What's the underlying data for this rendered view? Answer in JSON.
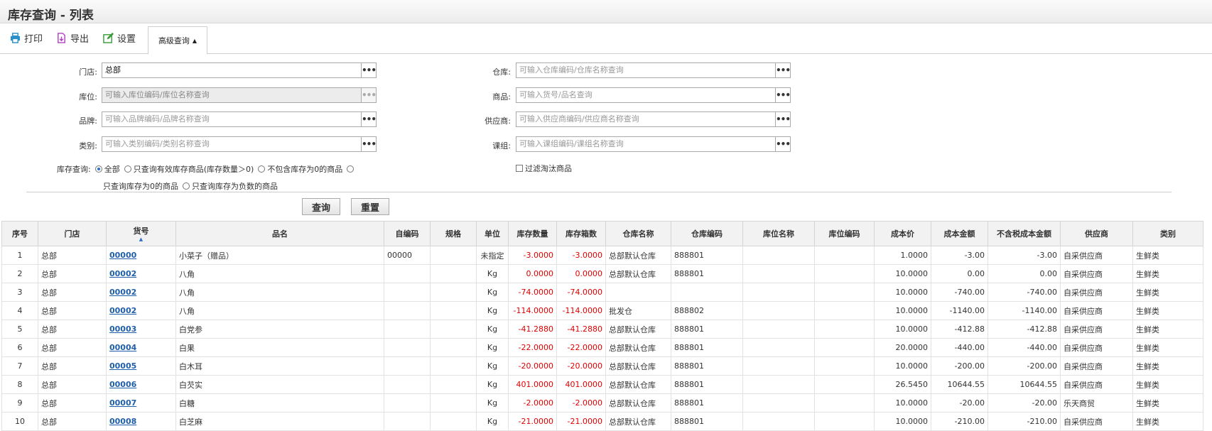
{
  "window": {
    "title": "库存查询 - 列表"
  },
  "toolbar": {
    "print": "打印",
    "export": "导出",
    "settings": "设置",
    "advanced": "高级查询"
  },
  "filters": {
    "store": {
      "label": "门店:",
      "value": "总部"
    },
    "location": {
      "label": "库位:",
      "placeholder": "可输入库位编码/库位名称查询"
    },
    "brand": {
      "label": "品牌:",
      "placeholder": "可输入品牌编码/品牌名称查询"
    },
    "category": {
      "label": "类别:",
      "placeholder": "可输入类别编码/类别名称查询"
    },
    "warehouse": {
      "label": "仓库:",
      "placeholder": "可输入仓库编码/仓库名称查询"
    },
    "product": {
      "label": "商品:",
      "placeholder": "可输入货号/品名查询"
    },
    "supplier": {
      "label": "供应商:",
      "placeholder": "可输入供应商编码/供应商名称查询"
    },
    "group": {
      "label": "课组:",
      "placeholder": "可输入课组编码/课组名称查询"
    },
    "stock_query": {
      "label": "库存查询:",
      "options": [
        "全部",
        "只查询有效库存商品(库存数量＞0)",
        "不包含库存为0的商品",
        "只查询库存为0的商品",
        "只查询库存为负数的商品"
      ],
      "selected": "全部"
    },
    "filter_eliminated": "过滤淘汰商品"
  },
  "actions": {
    "query": "查询",
    "reset": "重置"
  },
  "table": {
    "columns": [
      "序号",
      "门店",
      "货号",
      "品名",
      "自编码",
      "规格",
      "单位",
      "库存数量",
      "库存箱数",
      "仓库名称",
      "仓库编码",
      "库位名称",
      "库位编码",
      "成本价",
      "成本金额",
      "不含税成本金额",
      "供应商",
      "类别"
    ],
    "rows": [
      [
        "1",
        "总部",
        "00000",
        "小菜子（赠品）",
        "00000",
        "",
        "未指定",
        "-3.0000",
        "-3.0000",
        "总部默认仓库",
        "888801",
        "",
        "",
        "1.0000",
        "-3.00",
        "-3.00",
        "自采供应商",
        "生鲜类"
      ],
      [
        "2",
        "总部",
        "00002",
        "八角",
        "",
        "",
        "Kg",
        "0.0000",
        "0.0000",
        "总部默认仓库",
        "888801",
        "",
        "",
        "10.0000",
        "0.00",
        "0.00",
        "自采供应商",
        "生鲜类"
      ],
      [
        "3",
        "总部",
        "00002",
        "八角",
        "",
        "",
        "Kg",
        "-74.0000",
        "-74.0000",
        "",
        "",
        "",
        "",
        "10.0000",
        "-740.00",
        "-740.00",
        "自采供应商",
        "生鲜类"
      ],
      [
        "4",
        "总部",
        "00002",
        "八角",
        "",
        "",
        "Kg",
        "-114.0000",
        "-114.0000",
        "批发仓",
        "888802",
        "",
        "",
        "10.0000",
        "-1140.00",
        "-1140.00",
        "自采供应商",
        "生鲜类"
      ],
      [
        "5",
        "总部",
        "00003",
        "白党参",
        "",
        "",
        "Kg",
        "-41.2880",
        "-41.2880",
        "总部默认仓库",
        "888801",
        "",
        "",
        "10.0000",
        "-412.88",
        "-412.88",
        "自采供应商",
        "生鲜类"
      ],
      [
        "6",
        "总部",
        "00004",
        "白果",
        "",
        "",
        "Kg",
        "-22.0000",
        "-22.0000",
        "总部默认仓库",
        "888801",
        "",
        "",
        "20.0000",
        "-440.00",
        "-440.00",
        "自采供应商",
        "生鲜类"
      ],
      [
        "7",
        "总部",
        "00005",
        "白木耳",
        "",
        "",
        "Kg",
        "-20.0000",
        "-20.0000",
        "总部默认仓库",
        "888801",
        "",
        "",
        "10.0000",
        "-200.00",
        "-200.00",
        "自采供应商",
        "生鲜类"
      ],
      [
        "8",
        "总部",
        "00006",
        "白芡实",
        "",
        "",
        "Kg",
        "401.0000",
        "401.0000",
        "总部默认仓库",
        "888801",
        "",
        "",
        "26.5450",
        "10644.55",
        "10644.55",
        "自采供应商",
        "生鲜类"
      ],
      [
        "9",
        "总部",
        "00007",
        "白糖",
        "",
        "",
        "Kg",
        "-2.0000",
        "-2.0000",
        "总部默认仓库",
        "888801",
        "",
        "",
        "10.0000",
        "-20.00",
        "-20.00",
        "乐天商贸",
        "生鲜类"
      ],
      [
        "10",
        "总部",
        "00008",
        "白芝麻",
        "",
        "",
        "Kg",
        "-21.0000",
        "-21.0000",
        "总部默认仓库",
        "888801",
        "",
        "",
        "10.0000",
        "-210.00",
        "-210.00",
        "自采供应商",
        "生鲜类"
      ]
    ]
  }
}
